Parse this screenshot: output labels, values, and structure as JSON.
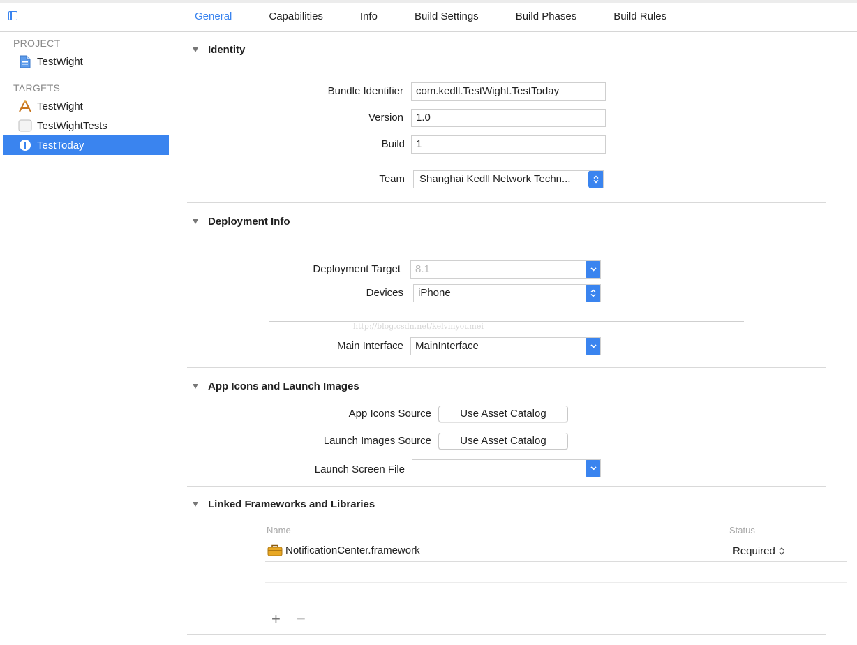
{
  "tabs": [
    "General",
    "Capabilities",
    "Info",
    "Build Settings",
    "Build Phases",
    "Build Rules"
  ],
  "sidebar": {
    "project_header": "PROJECT",
    "project_item": "TestWight",
    "targets_header": "TARGETS",
    "targets": [
      "TestWight",
      "TestWightTests",
      "TestToday"
    ]
  },
  "identity": {
    "title": "Identity",
    "bundle_label": "Bundle Identifier",
    "bundle_value": "com.kedll.TestWight.TestToday",
    "version_label": "Version",
    "version_value": "1.0",
    "build_label": "Build",
    "build_value": "1",
    "team_label": "Team",
    "team_value": "Shanghai Kedll Network Techn..."
  },
  "deployment": {
    "title": "Deployment Info",
    "target_label": "Deployment Target",
    "target_value": "8.1",
    "devices_label": "Devices",
    "devices_value": "iPhone",
    "watermark": "http://blog.csdn.net/kelvinyoumei",
    "main_interface_label": "Main Interface",
    "main_interface_value": "MainInterface"
  },
  "app_icons": {
    "title": "App Icons and Launch Images",
    "icons_source_label": "App Icons Source",
    "icons_source_button": "Use Asset Catalog",
    "launch_images_label": "Launch Images Source",
    "launch_images_button": "Use Asset Catalog",
    "launch_screen_label": "Launch Screen File",
    "launch_screen_value": ""
  },
  "linked": {
    "title": "Linked Frameworks and Libraries",
    "col_name": "Name",
    "col_status": "Status",
    "rows": [
      {
        "name": "NotificationCenter.framework",
        "status": "Required"
      }
    ],
    "add_symbol": "+",
    "remove_symbol": "−"
  },
  "colors": {
    "accent": "#3a84ef"
  },
  "icons": [
    "sidebar-toggle-icon",
    "project-file-icon",
    "app-target-icon",
    "test-bundle-icon",
    "extension-icon",
    "disclosure-triangle-icon",
    "popup-arrows-icon",
    "framework-toolbox-icon",
    "stepper-icon"
  ]
}
